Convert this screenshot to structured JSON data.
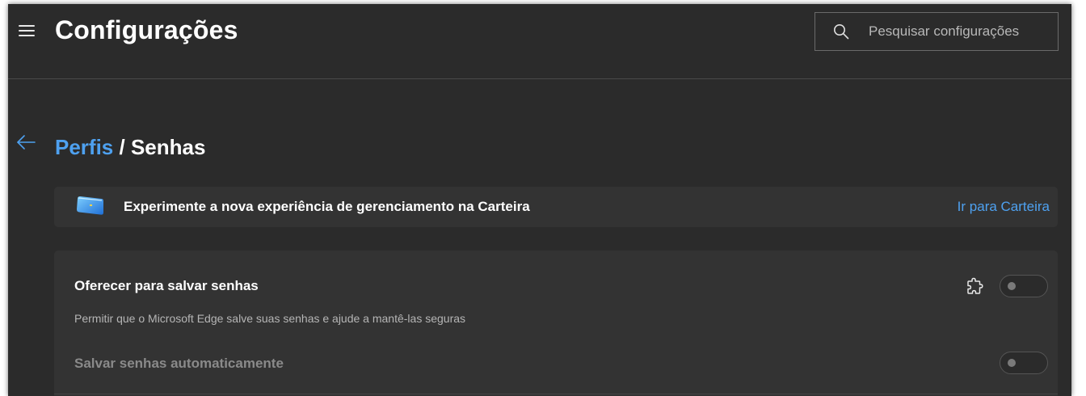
{
  "header": {
    "title": "Configurações",
    "menu_icon": "hamburger-menu-icon",
    "search": {
      "placeholder": "Pesquisar configurações",
      "value": "",
      "icon": "search-icon"
    }
  },
  "breadcrumb": {
    "back_icon": "arrow-left-icon",
    "parent": "Perfis",
    "separator": " / ",
    "current": "Senhas"
  },
  "banner": {
    "icon": "wallet-icon",
    "text": "Experimente a nova experiência de gerenciamento na Carteira",
    "link": "Ir para Carteira"
  },
  "settings": {
    "offer_save": {
      "title": "Oferecer para salvar senhas",
      "description": "Permitir que o Microsoft Edge salve suas senhas e ajude a mantê-las seguras",
      "managed_icon": "puzzle-piece-icon",
      "enabled": false
    },
    "auto_save": {
      "title": "Salvar senhas automaticamente",
      "enabled": false,
      "disabled": true
    }
  },
  "colors": {
    "background": "#2b2b2b",
    "card": "#333333",
    "accent_link": "#4ea1f0",
    "text_primary": "#ffffff",
    "text_secondary": "#b5b5b5",
    "text_disabled": "#8a8a8a"
  }
}
